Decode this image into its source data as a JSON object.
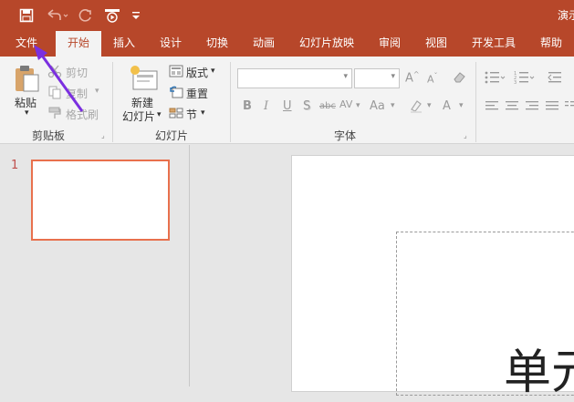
{
  "titlebar": {
    "title": "演示",
    "qat": [
      "save-icon",
      "undo-icon",
      "redo-icon",
      "slideshow-icon",
      "customize-icon"
    ]
  },
  "tabs": [
    {
      "label": "文件"
    },
    {
      "label": "开始"
    },
    {
      "label": "插入"
    },
    {
      "label": "设计"
    },
    {
      "label": "切换"
    },
    {
      "label": "动画"
    },
    {
      "label": "幻灯片放映"
    },
    {
      "label": "审阅"
    },
    {
      "label": "视图"
    },
    {
      "label": "开发工具"
    },
    {
      "label": "帮助"
    }
  ],
  "active_tab": "开始",
  "ribbon": {
    "clipboard": {
      "group_label": "剪贴板",
      "paste": "粘贴",
      "cut": "剪切",
      "copy": "复制",
      "format_painter": "格式刷"
    },
    "slides": {
      "group_label": "幻灯片",
      "new_slide_line1": "新建",
      "new_slide_line2": "幻灯片",
      "layout": "版式",
      "reset": "重置",
      "section": "节"
    },
    "font": {
      "group_label": "字体",
      "font_name": "",
      "font_size": "",
      "bold": "B",
      "italic": "I",
      "underline": "U",
      "shadow": "S",
      "strikethrough": "abc",
      "spacing": "AV",
      "change_case": "Aa",
      "color": "A"
    }
  },
  "thumbnails": {
    "slide_number": "1"
  },
  "slide": {
    "visible_text": "单元"
  },
  "colors": {
    "brand": "#b7472a",
    "thumb_border": "#e8704d",
    "annotation_arrow": "#7b2fe0"
  }
}
